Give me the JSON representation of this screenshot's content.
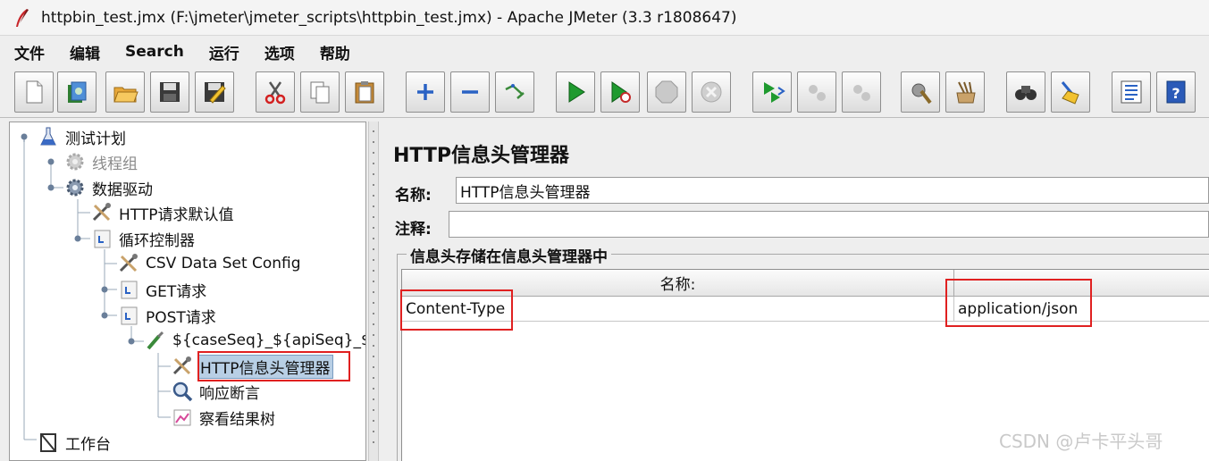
{
  "window": {
    "title": "httpbin_test.jmx (F:\\jmeter\\jmeter_scripts\\httpbin_test.jmx) - Apache JMeter (3.3 r1808647)"
  },
  "menu": [
    {
      "label": "文件"
    },
    {
      "label": "编辑"
    },
    {
      "label": "Search"
    },
    {
      "label": "运行"
    },
    {
      "label": "选项"
    },
    {
      "label": "帮助"
    }
  ],
  "toolbar": {
    "icons": [
      "new-icon",
      "templates-icon",
      "open-icon",
      "save-icon",
      "save-as-icon",
      "cut-icon",
      "copy-icon",
      "paste-icon",
      "expand-icon",
      "collapse-icon",
      "toggle-icon",
      "start-icon",
      "start-no-pause-icon",
      "stop-icon",
      "shutdown-icon",
      "remote-start-icon",
      "remote-stop-icon",
      "remote-shutdown-icon",
      "clear-icon",
      "clear-all-icon",
      "search-icon",
      "reset-search-icon",
      "function-helper-icon",
      "help-icon"
    ]
  },
  "tree": {
    "nodes": [
      {
        "label": "测试计划",
        "icon": "test-plan-icon"
      },
      {
        "label": "线程组",
        "icon": "thread-group-icon",
        "disabled": true
      },
      {
        "label": "数据驱动",
        "icon": "thread-group-icon"
      },
      {
        "label": "HTTP请求默认值",
        "icon": "config-element-icon"
      },
      {
        "label": "循环控制器",
        "icon": "controller-icon"
      },
      {
        "label": "CSV Data Set Config",
        "icon": "config-element-icon"
      },
      {
        "label": "GET请求",
        "icon": "controller-icon"
      },
      {
        "label": "POST请求",
        "icon": "controller-icon"
      },
      {
        "label": "${caseSeq}_${apiSeq}_$",
        "icon": "sampler-icon"
      },
      {
        "label": "HTTP信息头管理器",
        "icon": "config-element-icon",
        "selected": true
      },
      {
        "label": "响应断言",
        "icon": "assertion-icon"
      },
      {
        "label": "察看结果树",
        "icon": "listener-icon"
      },
      {
        "label": "工作台",
        "icon": "workbench-icon"
      }
    ]
  },
  "panel": {
    "title": "HTTP信息头管理器",
    "name_label": "名称:",
    "name_value": "HTTP信息头管理器",
    "comment_label": "注释:",
    "comment_value": "",
    "group_title": "信息头存储在信息头管理器中",
    "table": {
      "columns": [
        "名称:",
        ""
      ],
      "rows": [
        {
          "name": "Content-Type",
          "value": "application/json"
        }
      ]
    }
  },
  "watermark": "CSDN @卢卡平头哥",
  "colors": {
    "highlight": "#e02020",
    "selection": "#b8cfe5"
  }
}
